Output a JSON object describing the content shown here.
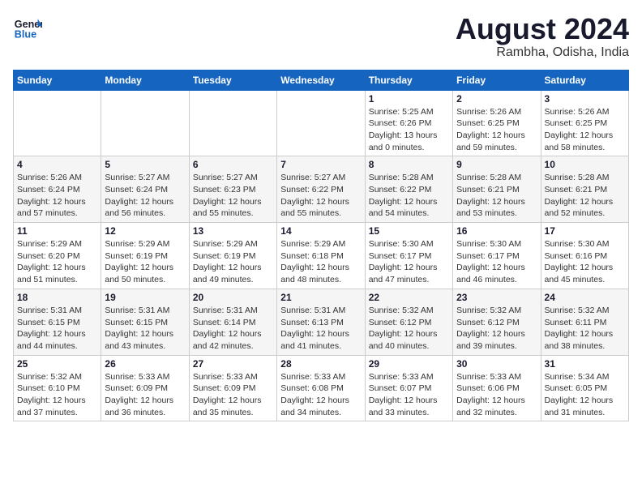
{
  "logo": {
    "line1": "General",
    "line2": "Blue"
  },
  "title": "August 2024",
  "location": "Rambha, Odisha, India",
  "weekdays": [
    "Sunday",
    "Monday",
    "Tuesday",
    "Wednesday",
    "Thursday",
    "Friday",
    "Saturday"
  ],
  "weeks": [
    [
      {
        "day": "",
        "info": ""
      },
      {
        "day": "",
        "info": ""
      },
      {
        "day": "",
        "info": ""
      },
      {
        "day": "",
        "info": ""
      },
      {
        "day": "1",
        "info": "Sunrise: 5:25 AM\nSunset: 6:26 PM\nDaylight: 13 hours\nand 0 minutes."
      },
      {
        "day": "2",
        "info": "Sunrise: 5:26 AM\nSunset: 6:25 PM\nDaylight: 12 hours\nand 59 minutes."
      },
      {
        "day": "3",
        "info": "Sunrise: 5:26 AM\nSunset: 6:25 PM\nDaylight: 12 hours\nand 58 minutes."
      }
    ],
    [
      {
        "day": "4",
        "info": "Sunrise: 5:26 AM\nSunset: 6:24 PM\nDaylight: 12 hours\nand 57 minutes."
      },
      {
        "day": "5",
        "info": "Sunrise: 5:27 AM\nSunset: 6:24 PM\nDaylight: 12 hours\nand 56 minutes."
      },
      {
        "day": "6",
        "info": "Sunrise: 5:27 AM\nSunset: 6:23 PM\nDaylight: 12 hours\nand 55 minutes."
      },
      {
        "day": "7",
        "info": "Sunrise: 5:27 AM\nSunset: 6:22 PM\nDaylight: 12 hours\nand 55 minutes."
      },
      {
        "day": "8",
        "info": "Sunrise: 5:28 AM\nSunset: 6:22 PM\nDaylight: 12 hours\nand 54 minutes."
      },
      {
        "day": "9",
        "info": "Sunrise: 5:28 AM\nSunset: 6:21 PM\nDaylight: 12 hours\nand 53 minutes."
      },
      {
        "day": "10",
        "info": "Sunrise: 5:28 AM\nSunset: 6:21 PM\nDaylight: 12 hours\nand 52 minutes."
      }
    ],
    [
      {
        "day": "11",
        "info": "Sunrise: 5:29 AM\nSunset: 6:20 PM\nDaylight: 12 hours\nand 51 minutes."
      },
      {
        "day": "12",
        "info": "Sunrise: 5:29 AM\nSunset: 6:19 PM\nDaylight: 12 hours\nand 50 minutes."
      },
      {
        "day": "13",
        "info": "Sunrise: 5:29 AM\nSunset: 6:19 PM\nDaylight: 12 hours\nand 49 minutes."
      },
      {
        "day": "14",
        "info": "Sunrise: 5:29 AM\nSunset: 6:18 PM\nDaylight: 12 hours\nand 48 minutes."
      },
      {
        "day": "15",
        "info": "Sunrise: 5:30 AM\nSunset: 6:17 PM\nDaylight: 12 hours\nand 47 minutes."
      },
      {
        "day": "16",
        "info": "Sunrise: 5:30 AM\nSunset: 6:17 PM\nDaylight: 12 hours\nand 46 minutes."
      },
      {
        "day": "17",
        "info": "Sunrise: 5:30 AM\nSunset: 6:16 PM\nDaylight: 12 hours\nand 45 minutes."
      }
    ],
    [
      {
        "day": "18",
        "info": "Sunrise: 5:31 AM\nSunset: 6:15 PM\nDaylight: 12 hours\nand 44 minutes."
      },
      {
        "day": "19",
        "info": "Sunrise: 5:31 AM\nSunset: 6:15 PM\nDaylight: 12 hours\nand 43 minutes."
      },
      {
        "day": "20",
        "info": "Sunrise: 5:31 AM\nSunset: 6:14 PM\nDaylight: 12 hours\nand 42 minutes."
      },
      {
        "day": "21",
        "info": "Sunrise: 5:31 AM\nSunset: 6:13 PM\nDaylight: 12 hours\nand 41 minutes."
      },
      {
        "day": "22",
        "info": "Sunrise: 5:32 AM\nSunset: 6:12 PM\nDaylight: 12 hours\nand 40 minutes."
      },
      {
        "day": "23",
        "info": "Sunrise: 5:32 AM\nSunset: 6:12 PM\nDaylight: 12 hours\nand 39 minutes."
      },
      {
        "day": "24",
        "info": "Sunrise: 5:32 AM\nSunset: 6:11 PM\nDaylight: 12 hours\nand 38 minutes."
      }
    ],
    [
      {
        "day": "25",
        "info": "Sunrise: 5:32 AM\nSunset: 6:10 PM\nDaylight: 12 hours\nand 37 minutes."
      },
      {
        "day": "26",
        "info": "Sunrise: 5:33 AM\nSunset: 6:09 PM\nDaylight: 12 hours\nand 36 minutes."
      },
      {
        "day": "27",
        "info": "Sunrise: 5:33 AM\nSunset: 6:09 PM\nDaylight: 12 hours\nand 35 minutes."
      },
      {
        "day": "28",
        "info": "Sunrise: 5:33 AM\nSunset: 6:08 PM\nDaylight: 12 hours\nand 34 minutes."
      },
      {
        "day": "29",
        "info": "Sunrise: 5:33 AM\nSunset: 6:07 PM\nDaylight: 12 hours\nand 33 minutes."
      },
      {
        "day": "30",
        "info": "Sunrise: 5:33 AM\nSunset: 6:06 PM\nDaylight: 12 hours\nand 32 minutes."
      },
      {
        "day": "31",
        "info": "Sunrise: 5:34 AM\nSunset: 6:05 PM\nDaylight: 12 hours\nand 31 minutes."
      }
    ]
  ]
}
